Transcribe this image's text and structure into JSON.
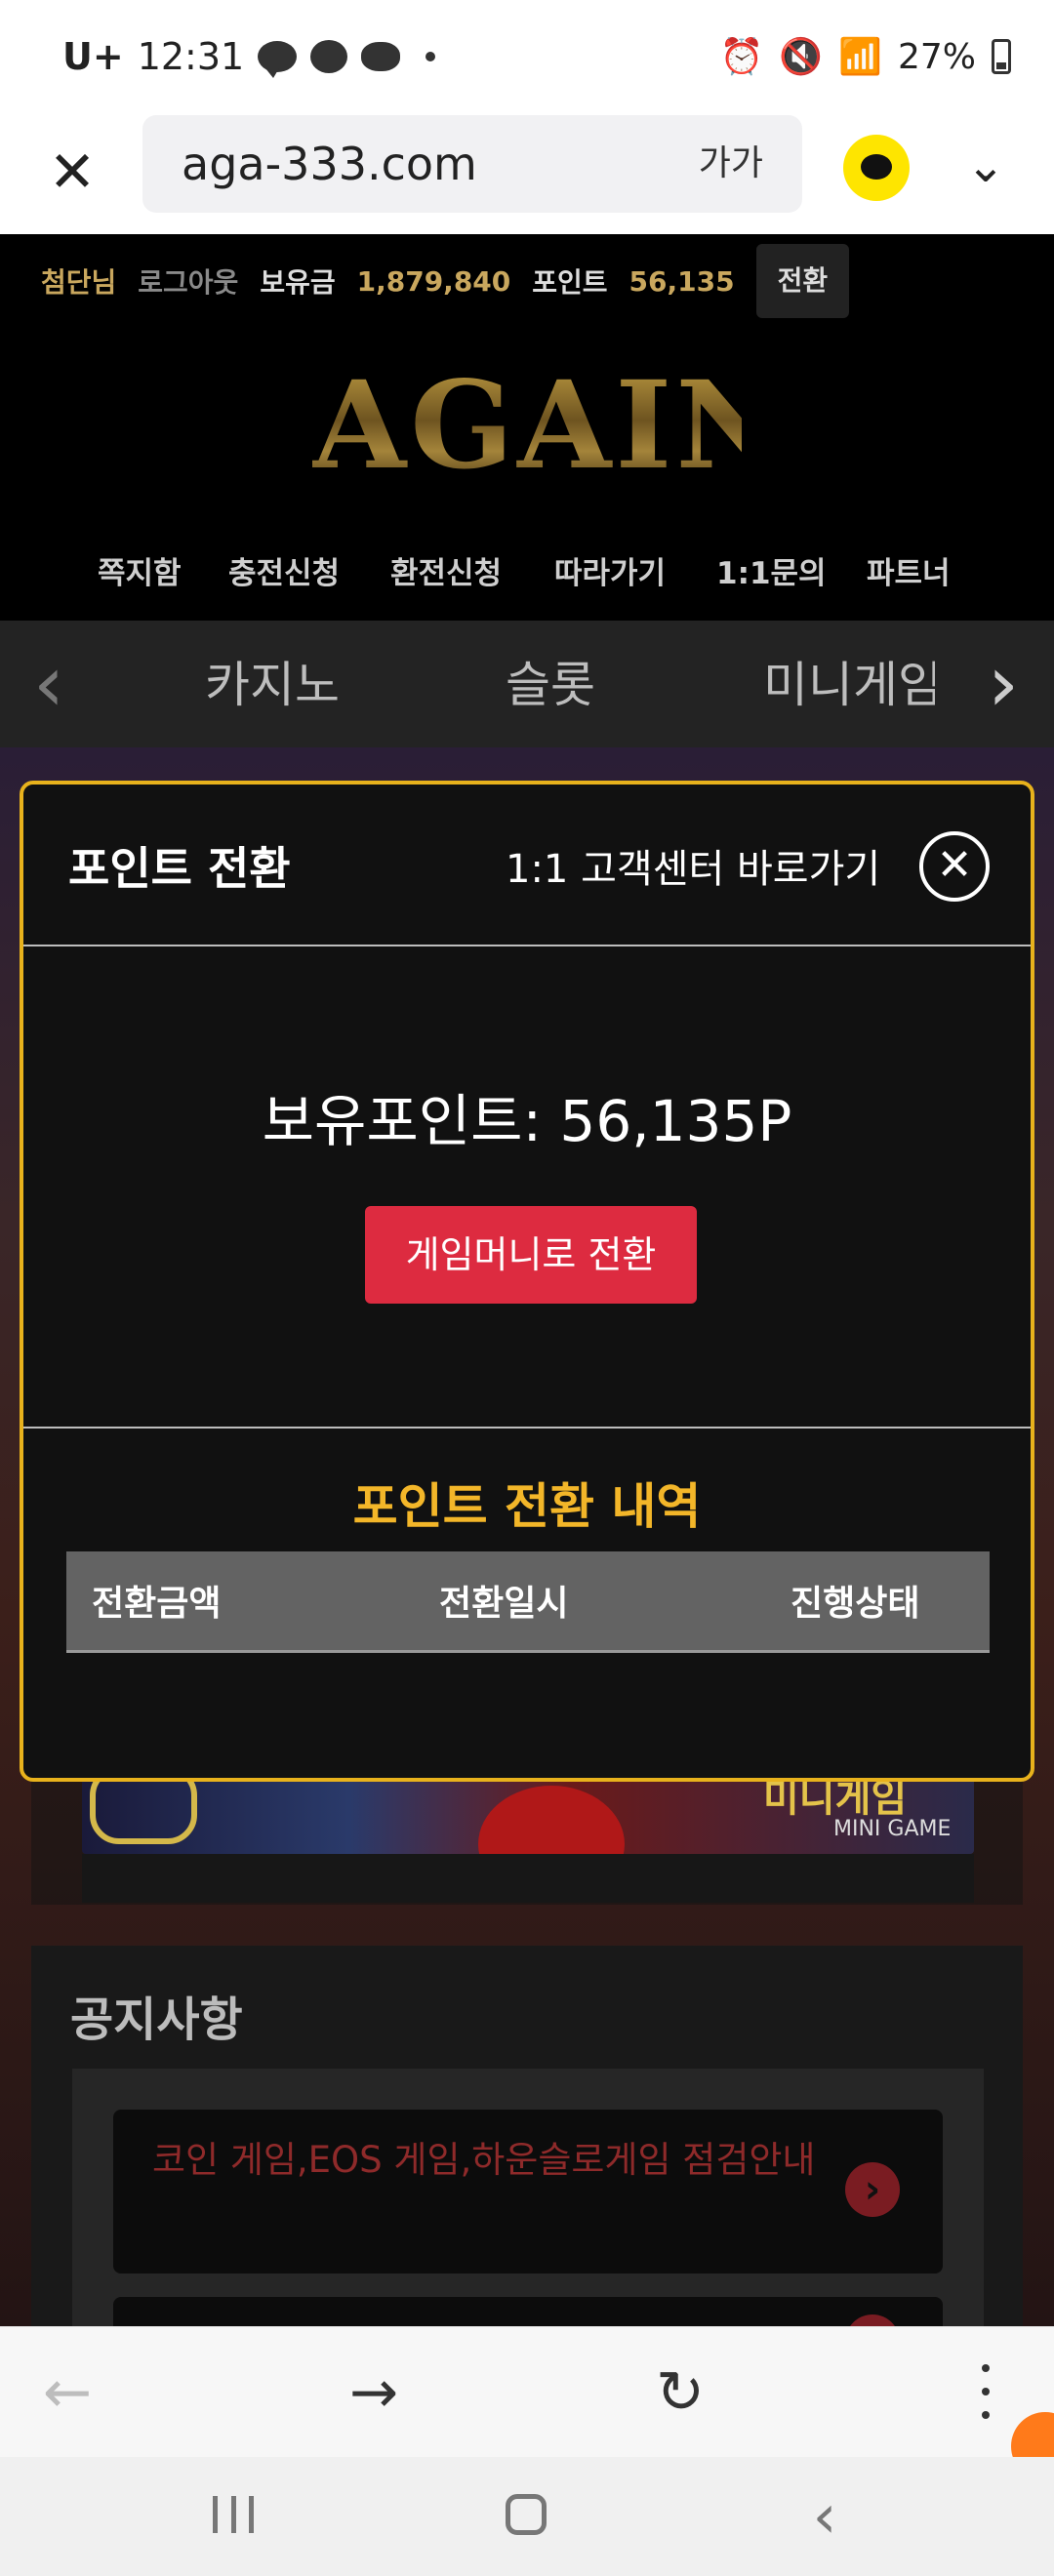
{
  "status_bar": {
    "carrier": "U+",
    "time": "12:31",
    "battery": "27%",
    "icons": [
      "kakaotalk-icon",
      "chat-icon",
      "pig-icon",
      "dot-icon",
      "alarm-icon",
      "mute-icon",
      "wifi-icon",
      "signal-icon",
      "battery-icon"
    ]
  },
  "browser": {
    "url": "aga-333.com",
    "text_size_label": "가가",
    "icons": [
      "close-icon",
      "kakao-icon",
      "chevron-down-icon"
    ]
  },
  "user_bar": {
    "username": "첨단님",
    "logout": "로그아웃",
    "balance_label": "보유금",
    "balance_value": "1,879,840",
    "points_label": "포인트",
    "points_value": "56,135",
    "exchange_button": "전환"
  },
  "logo": {
    "text": "AGAIN"
  },
  "top_nav": [
    "쪽지함",
    "충전신청",
    "환전신청",
    "따라가기",
    "1:1문의",
    "파트너"
  ],
  "categories": [
    "카지노",
    "슬롯",
    "미니게임"
  ],
  "banner": {
    "label_kr": "미니게임",
    "label_en": "MINI GAME"
  },
  "notice": {
    "title": "공지사항",
    "items": [
      "코인 게임,EOS 게임,하운슬로게임 점검안내"
    ]
  },
  "modal": {
    "title": "포인트 전환",
    "cs_link": "1:1 고객센터 바로가기",
    "points_line": "보유포인트: 56,135P",
    "convert_button": "게임머니로 전환",
    "history_title": "포인트 전환 내역",
    "history_columns": [
      "전환금액",
      "전환일시",
      "진행상태"
    ]
  },
  "colors": {
    "modal_border": "#e8b21c",
    "accent_red": "#dd2b40",
    "gold_text": "#c9a75e",
    "history_title": "#f3b629"
  }
}
